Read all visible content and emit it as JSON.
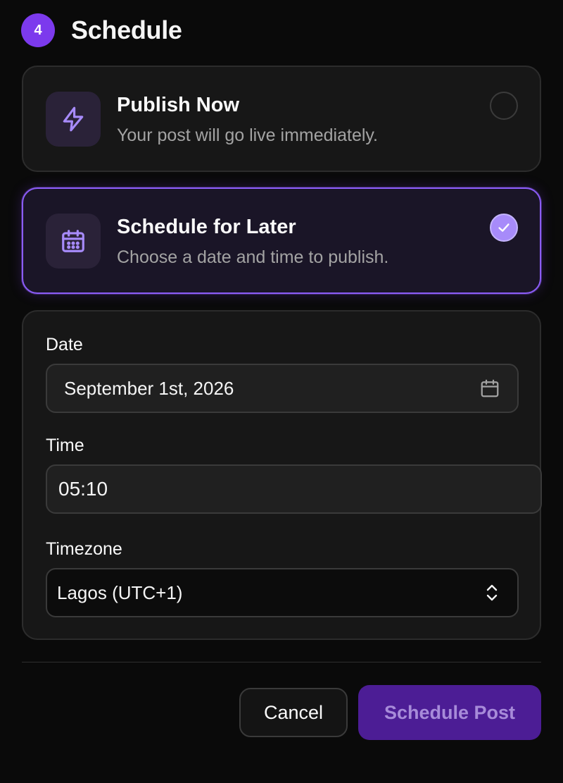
{
  "header": {
    "step_number": "4",
    "title": "Schedule"
  },
  "options": [
    {
      "title": "Publish Now",
      "subtitle": "Your post will go live immediately.",
      "icon": "lightning-icon",
      "selected": false
    },
    {
      "title": "Schedule for Later",
      "subtitle": "Choose a date and time to publish.",
      "icon": "calendar-icon",
      "selected": true
    }
  ],
  "form": {
    "date_label": "Date",
    "date_value": "September 1st, 2026",
    "time_label": "Time",
    "time_value": "05:10",
    "timezone_label": "Timezone",
    "timezone_value": "Lagos (UTC+1)"
  },
  "actions": {
    "cancel_label": "Cancel",
    "submit_label": "Schedule Post"
  },
  "colors": {
    "accent": "#7c3aed",
    "accent_light": "#a78bfa",
    "background": "#0a0a0a",
    "surface": "#171717"
  }
}
